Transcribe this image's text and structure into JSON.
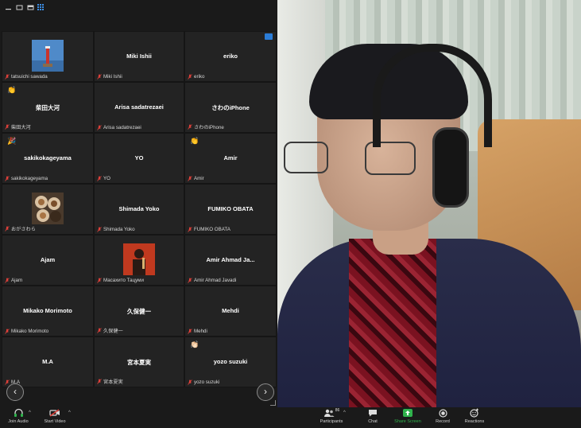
{
  "gallery": {
    "tiles": [
      {
        "name": "",
        "label": "tatsuichi sawada",
        "thumb": "lighthouse",
        "reaction": ""
      },
      {
        "name": "Miki Ishii",
        "label": "Miki Ishii",
        "thumb": "",
        "reaction": ""
      },
      {
        "name": "eriko",
        "label": "eriko",
        "thumb": "",
        "reaction": ""
      },
      {
        "name": "柴田大河",
        "label": "柴田大河",
        "thumb": "",
        "reaction": "👏"
      },
      {
        "name": "Arisa sadatrezaei",
        "label": "Arisa sadatrezaei",
        "thumb": "",
        "reaction": ""
      },
      {
        "name": "さわのiPhone",
        "label": "さわのiPhone",
        "thumb": "",
        "reaction": ""
      },
      {
        "name": "sakikokageyama",
        "label": "sakikokageyama",
        "thumb": "",
        "reaction": "🎉"
      },
      {
        "name": "YO",
        "label": "YO",
        "thumb": "",
        "reaction": ""
      },
      {
        "name": "Amir",
        "label": "Amir",
        "thumb": "",
        "reaction": "👏"
      },
      {
        "name": "",
        "label": "おがさわら",
        "thumb": "coffee",
        "reaction": ""
      },
      {
        "name": "Shimada Yoko",
        "label": "Shimada Yoko",
        "thumb": "",
        "reaction": ""
      },
      {
        "name": "FUMIKO OBATA",
        "label": "FUMIKO OBATA",
        "thumb": "",
        "reaction": ""
      },
      {
        "name": "Ajam",
        "label": "Ajam",
        "thumb": "",
        "reaction": ""
      },
      {
        "name": "",
        "label": "Масахито Тацуми",
        "thumb": "performer",
        "reaction": ""
      },
      {
        "name": "Amir  Ahmad Ja...",
        "label": "Amir  Ahmad Javadi",
        "thumb": "",
        "reaction": ""
      },
      {
        "name": "Mikako Morimoto",
        "label": "Mikako Morimoto",
        "thumb": "",
        "reaction": ""
      },
      {
        "name": "久保健一",
        "label": "久保健一",
        "thumb": "",
        "reaction": ""
      },
      {
        "name": "Mehdi",
        "label": "Mehdi",
        "thumb": "",
        "reaction": ""
      },
      {
        "name": "M.A",
        "label": "M.A",
        "thumb": "",
        "reaction": ""
      },
      {
        "name": "宮本夏実",
        "label": "宮本夏実",
        "thumb": "",
        "reaction": ""
      },
      {
        "name": "yozo suzuki",
        "label": "yozo suzuki",
        "thumb": "",
        "reaction": "👏🏻"
      }
    ],
    "prev_icon": "chevron-left-icon",
    "next_icon": "chevron-right-icon"
  },
  "toolbar": {
    "join_audio": "Join Audio",
    "start_video": "Start Video",
    "participants": "Participants",
    "participants_count": "86",
    "chat": "Chat",
    "share_screen": "Share Screen",
    "record": "Record",
    "reactions": "Reactions"
  },
  "colors": {
    "share_green": "#2fb24c",
    "muted_red": "#e0403a",
    "tile_bg": "#232323",
    "accent_blue": "#2b7cd7"
  }
}
